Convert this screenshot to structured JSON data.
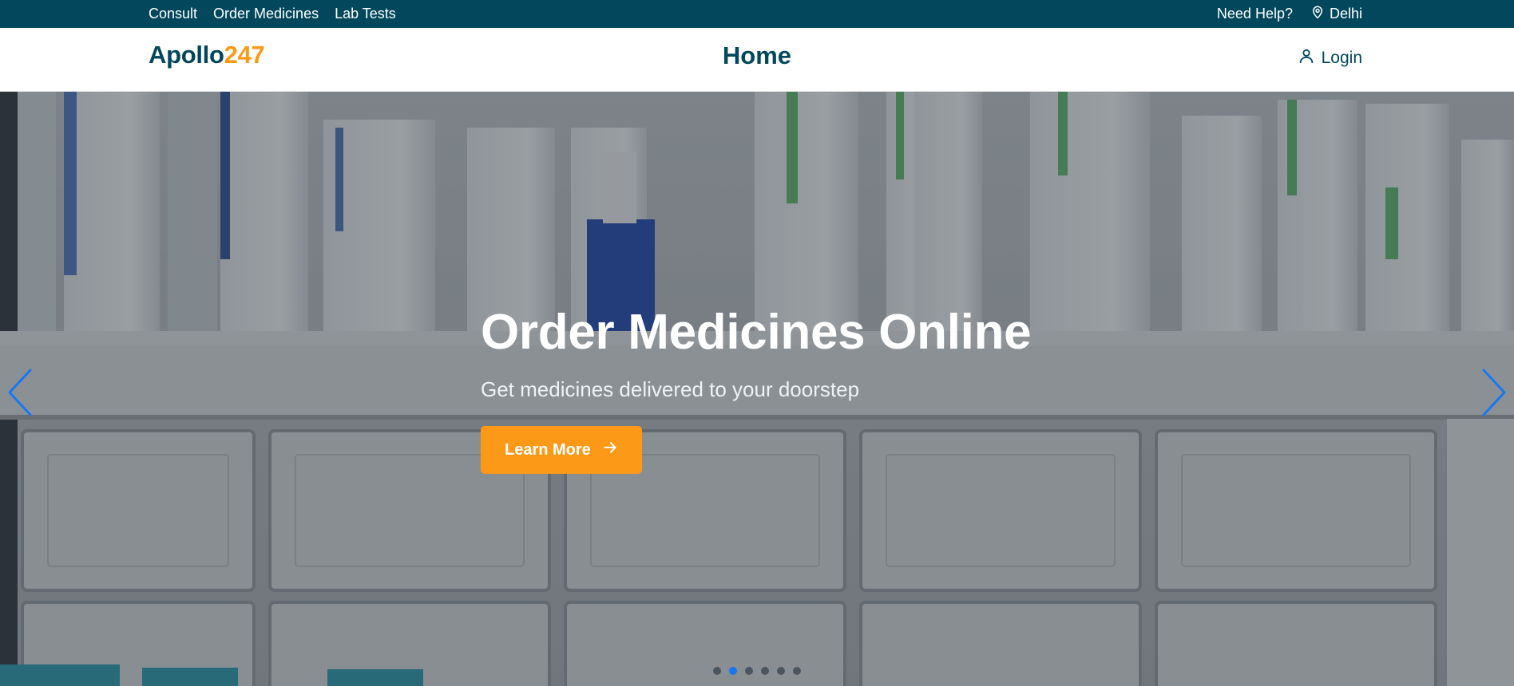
{
  "topbar": {
    "links": [
      "Consult",
      "Order Medicines",
      "Lab Tests"
    ],
    "need_help": "Need Help?",
    "location": "Delhi"
  },
  "header": {
    "logo_primary": "Apollo",
    "logo_accent": "247",
    "title": "Home",
    "login_label": "Login"
  },
  "hero": {
    "title": "Order Medicines Online",
    "subtitle": "Get medicines delivered to your doorstep",
    "cta_label": "Learn More",
    "slide_count": 6,
    "active_slide": 1
  },
  "colors": {
    "brand_dark": "#02475b",
    "brand_accent": "#fc9916",
    "carousel_arrow": "#1877f2",
    "dot_active": "#1877f2"
  },
  "icons": [
    "map-pin-icon",
    "user-icon",
    "arrow-right-icon",
    "chevron-left-icon",
    "chevron-right-icon"
  ]
}
